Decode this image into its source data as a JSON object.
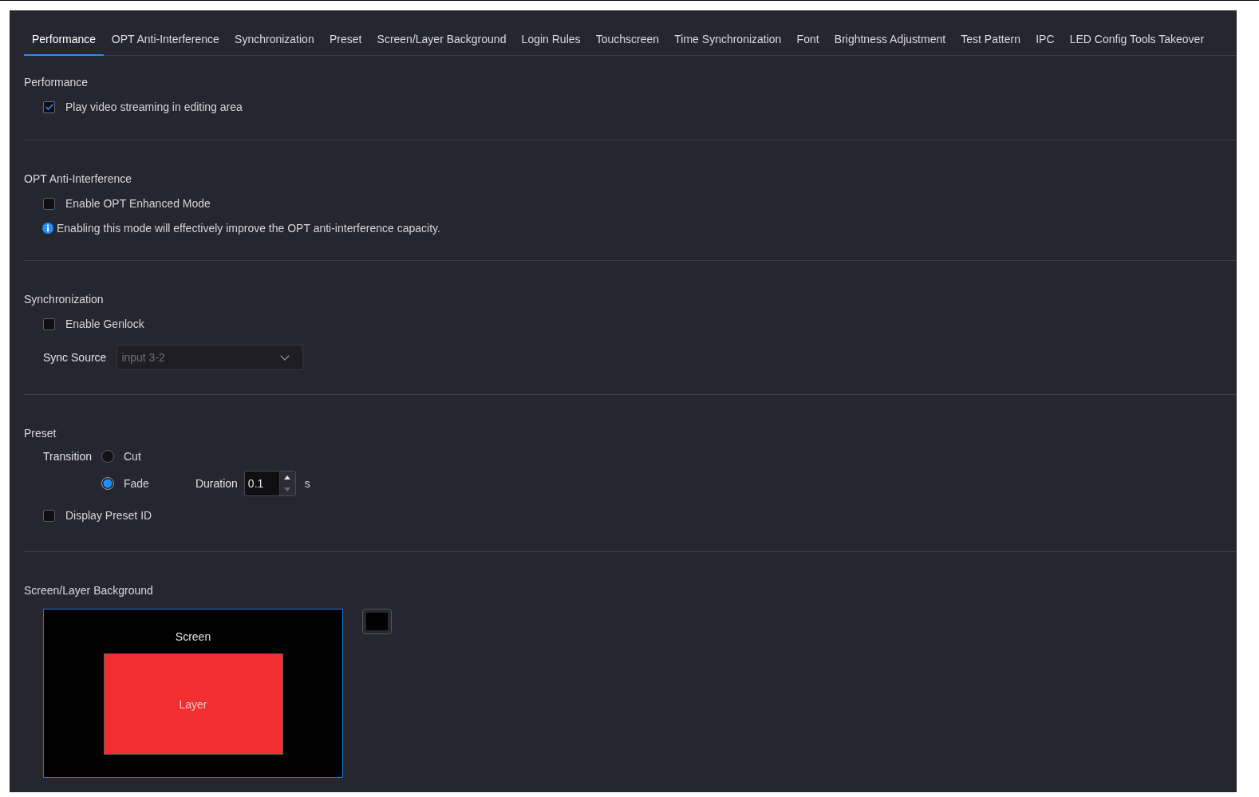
{
  "tabs": [
    {
      "label": "Performance",
      "selected": true
    },
    {
      "label": "OPT Anti-Interference",
      "selected": false
    },
    {
      "label": "Synchronization",
      "selected": false
    },
    {
      "label": "Preset",
      "selected": false
    },
    {
      "label": "Screen/Layer Background",
      "selected": false
    },
    {
      "label": "Login Rules",
      "selected": false
    },
    {
      "label": "Touchscreen",
      "selected": false
    },
    {
      "label": "Time Synchronization",
      "selected": false
    },
    {
      "label": "Font",
      "selected": false
    },
    {
      "label": "Brightness Adjustment",
      "selected": false
    },
    {
      "label": "Test Pattern",
      "selected": false
    },
    {
      "label": "IPC",
      "selected": false
    },
    {
      "label": "LED Config Tools Takeover",
      "selected": false
    }
  ],
  "performance": {
    "title": "Performance",
    "checkboxes": [
      {
        "label": "Play video streaming in editing area",
        "checked": true
      }
    ]
  },
  "opt_anti_interference": {
    "title": "OPT Anti-Interference",
    "checkboxes": [
      {
        "label": "Enable OPT Enhanced Mode",
        "checked": false
      }
    ],
    "note": "Enabling this mode will effectively improve the OPT anti-interference capacity."
  },
  "synchronization": {
    "title": "Synchronization",
    "checkboxes": [
      {
        "label": "Enable Genlock",
        "checked": false
      }
    ],
    "sync_source": {
      "label": "Sync Source",
      "value": "input 3-2",
      "disabled": true
    }
  },
  "preset": {
    "title": "Preset",
    "transition": {
      "label": "Transition",
      "options": [
        {
          "label": "Cut",
          "selected": false
        },
        {
          "label": "Fade",
          "selected": true,
          "duration": {
            "label": "Duration",
            "value": "0.1",
            "unit": "s"
          }
        }
      ]
    },
    "checkboxes": [
      {
        "label": "Display Preset ID",
        "checked": false
      }
    ]
  },
  "background": {
    "title": "Screen/Layer Background",
    "screen_label": "Screen",
    "layer_label": "Layer"
  }
}
